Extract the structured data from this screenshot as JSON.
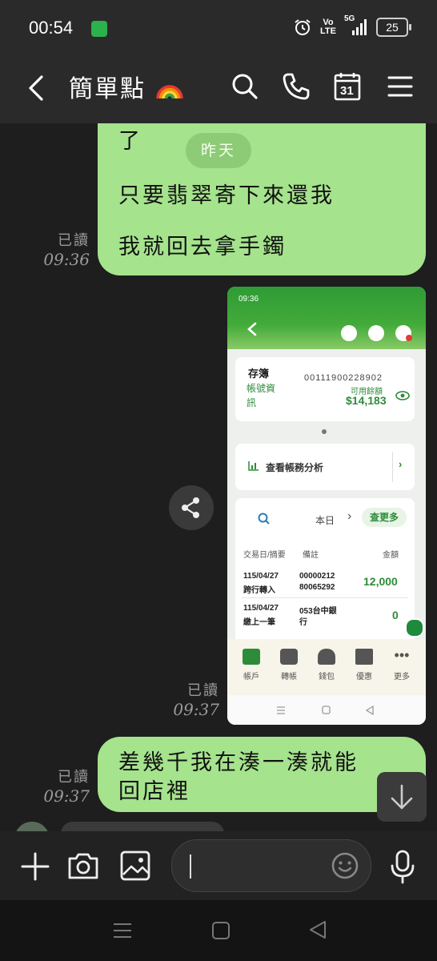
{
  "status_bar": {
    "time": "00:54",
    "network": "5G",
    "volte_top": "Vo",
    "volte_bottom": "LTE",
    "battery": "25"
  },
  "header": {
    "title": "簡單點",
    "icons": [
      "back-icon",
      "search-icon",
      "phone-icon",
      "calendar-icon",
      "menu-icon"
    ],
    "calendar_day": "31"
  },
  "messages": {
    "m1_line_top": "了",
    "date_divider": "昨天",
    "m1_line1": "只要翡翠寄下來還我",
    "m1_line2": "我就回去拿手鐲",
    "m1_read": "已讀",
    "m1_time": "09:36",
    "m2_read": "已讀",
    "m2_time": "09:37",
    "m3_line1": "差幾千我在湊一湊就能",
    "m3_line2": "回店裡",
    "m3_read": "已讀",
    "m3_time": "09:37"
  },
  "screenshot": {
    "status_time": "09:36",
    "account_type": "存簿",
    "account_number": "00111900228902",
    "account_info_link_1": "帳號資",
    "account_info_link_2": "訊",
    "available_label": "可用餘額",
    "balance": "$14,183",
    "analysis_link": "查看帳務分析",
    "filter_label": "本日",
    "more_button": "查更多",
    "col_date": "交易日/摘要",
    "col_note": "備註",
    "col_amount": "金額",
    "rows": [
      {
        "date": "115/04/27",
        "desc": "跨行轉入",
        "note1": "00000212",
        "note2": "80065292",
        "amount": "12,000"
      },
      {
        "date": "115/04/27",
        "desc": "繳上一筆",
        "note1": "053台中銀",
        "note2": "行",
        "amount": "0"
      }
    ],
    "nav": [
      "帳戶",
      "轉帳",
      "錢包",
      "優惠",
      "更多"
    ]
  },
  "colors": {
    "bubble": "#a5e38d",
    "bank_green": "#2f9b35",
    "background": "#1e1e1e"
  }
}
